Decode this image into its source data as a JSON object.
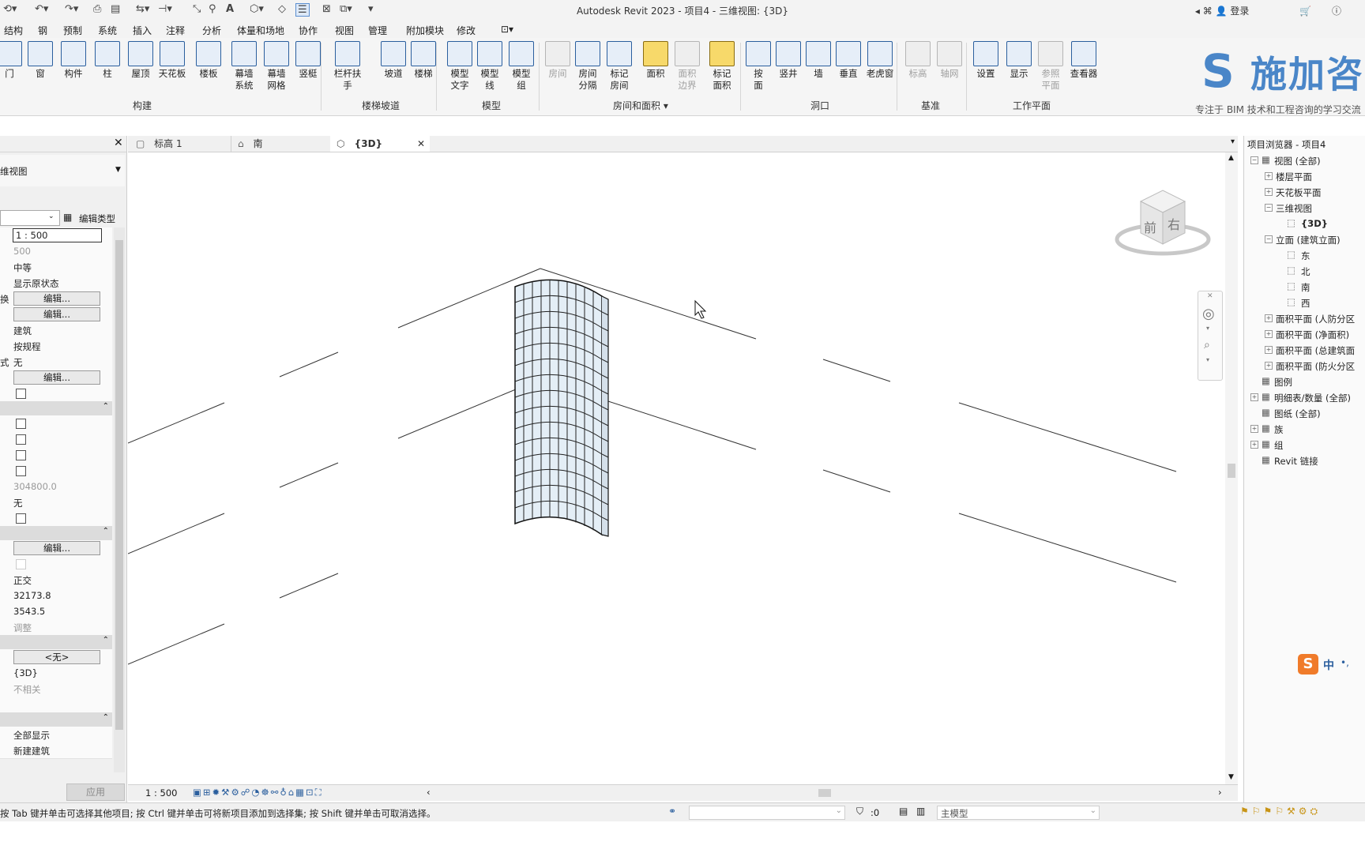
{
  "window": {
    "title": "Autodesk Revit 2023 - 项目4 - 三维视图: {3D}",
    "login": "登录",
    "help": "?"
  },
  "menu_tabs": [
    "结构",
    "钢",
    "预制",
    "系统",
    "插入",
    "注释",
    "分析",
    "体量和场地",
    "协作",
    "视图",
    "管理",
    "附加模块",
    "修改"
  ],
  "ribbon": {
    "build_buttons": [
      "门",
      "窗",
      "构件",
      "柱",
      "屋顶",
      "天花板",
      "楼板",
      "幕墙\n系统",
      "幕墙\n网格",
      "竖梃"
    ],
    "stair_buttons": [
      "栏杆扶手",
      "坡道",
      "楼梯"
    ],
    "model_buttons": [
      "模型\n文字",
      "模型\n线",
      "模型\n组"
    ],
    "room_buttons": [
      "房间",
      "房间\n分隔",
      "标记\n房间",
      "面积",
      "面积\n边界",
      "标记\n面积"
    ],
    "opening_buttons": [
      "按\n面",
      "竖井",
      "墙",
      "垂直",
      "老虎窗"
    ],
    "datum_buttons": [
      "标高",
      "轴网"
    ],
    "workplane_buttons": [
      "设置",
      "显示",
      "参照\n平面",
      "查看器"
    ],
    "panels": {
      "build": "构建",
      "stair": "楼梯坡道",
      "model": "模型",
      "room": "房间和面积 ▾",
      "opening": "洞口",
      "datum": "基准",
      "workplane": "工作平面"
    },
    "logo_text": "施加咨",
    "logo_tagline": "专注于 BIM 技术和工程咨询的学习交流"
  },
  "properties": {
    "type_label": "维视图",
    "edit_type": "编辑类型",
    "rows": [
      {
        "kind": "input",
        "value": "1 : 500"
      },
      {
        "kind": "text",
        "value": "500",
        "gray": true
      },
      {
        "kind": "text",
        "value": "中等"
      },
      {
        "kind": "text",
        "value": "显示原状态"
      },
      {
        "kind": "button",
        "value": "编辑...",
        "key": "换"
      },
      {
        "kind": "button",
        "value": "编辑..."
      },
      {
        "kind": "text",
        "value": "建筑"
      },
      {
        "kind": "text",
        "value": "按规程"
      },
      {
        "kind": "text",
        "value": "无",
        "key": "式"
      },
      {
        "kind": "button",
        "value": "编辑..."
      },
      {
        "kind": "check"
      },
      {
        "kind": "header"
      },
      {
        "kind": "check"
      },
      {
        "kind": "check"
      },
      {
        "kind": "check"
      },
      {
        "kind": "check"
      },
      {
        "kind": "text",
        "value": "304800.0",
        "gray": true
      },
      {
        "kind": "text",
        "value": "无"
      },
      {
        "kind": "check"
      },
      {
        "kind": "header"
      },
      {
        "kind": "button",
        "value": "编辑..."
      },
      {
        "kind": "check",
        "gray": true
      },
      {
        "kind": "text",
        "value": "正交"
      },
      {
        "kind": "text",
        "value": "32173.8"
      },
      {
        "kind": "text",
        "value": "3543.5"
      },
      {
        "kind": "text",
        "value": "调整",
        "gray": true
      },
      {
        "kind": "header"
      },
      {
        "kind": "button",
        "value": "<无>"
      },
      {
        "kind": "text",
        "value": "{3D}"
      },
      {
        "kind": "text",
        "value": "不相关",
        "gray": true
      },
      {
        "kind": "blank"
      },
      {
        "kind": "header"
      },
      {
        "kind": "text",
        "value": "全部显示"
      },
      {
        "kind": "text",
        "value": "新建建筑"
      }
    ],
    "apply": "应用"
  },
  "view_tabs": [
    {
      "label": "标高 1",
      "active": false
    },
    {
      "label": "南",
      "active": false
    },
    {
      "label": "{3D}",
      "active": true
    }
  ],
  "view_control": {
    "scale": "1 : 500"
  },
  "viewcube": {
    "front": "前",
    "right": "右"
  },
  "browser": {
    "title": "项目浏览器 - 项目4",
    "items": [
      {
        "label": "视图 (全部)",
        "level": 0,
        "toggle": "−"
      },
      {
        "label": "楼层平面",
        "level": 1,
        "toggle": "+"
      },
      {
        "label": "天花板平面",
        "level": 1,
        "toggle": "+"
      },
      {
        "label": "三维视图",
        "level": 1,
        "toggle": "−"
      },
      {
        "label": "{3D}",
        "level": 2,
        "toggle": "",
        "bold": true
      },
      {
        "label": "立面 (建筑立面)",
        "level": 1,
        "toggle": "−"
      },
      {
        "label": "东",
        "level": 2,
        "toggle": ""
      },
      {
        "label": "北",
        "level": 2,
        "toggle": ""
      },
      {
        "label": "南",
        "level": 2,
        "toggle": ""
      },
      {
        "label": "西",
        "level": 2,
        "toggle": ""
      },
      {
        "label": "面积平面 (人防分区",
        "level": 1,
        "toggle": "+"
      },
      {
        "label": "面积平面 (净面积)",
        "level": 1,
        "toggle": "+"
      },
      {
        "label": "面积平面 (总建筑面",
        "level": 1,
        "toggle": "+"
      },
      {
        "label": "面积平面 (防火分区",
        "level": 1,
        "toggle": "+"
      },
      {
        "label": "图例",
        "level": 0,
        "toggle": ""
      },
      {
        "label": "明细表/数量 (全部)",
        "level": 0,
        "toggle": "+"
      },
      {
        "label": "图纸 (全部)",
        "level": 0,
        "toggle": ""
      },
      {
        "label": "族",
        "level": 0,
        "toggle": "+"
      },
      {
        "label": "组",
        "level": 0,
        "toggle": "+"
      },
      {
        "label": "Revit 链接",
        "level": 0,
        "toggle": ""
      }
    ]
  },
  "ime": "中",
  "status": {
    "message": "按 Tab 键并单击可选择其他项目; 按 Ctrl 键并单击可将新项目添加到选择集; 按 Shift 键并单击可取消选择。",
    "selection_count": ":0",
    "workset": "主模型"
  }
}
